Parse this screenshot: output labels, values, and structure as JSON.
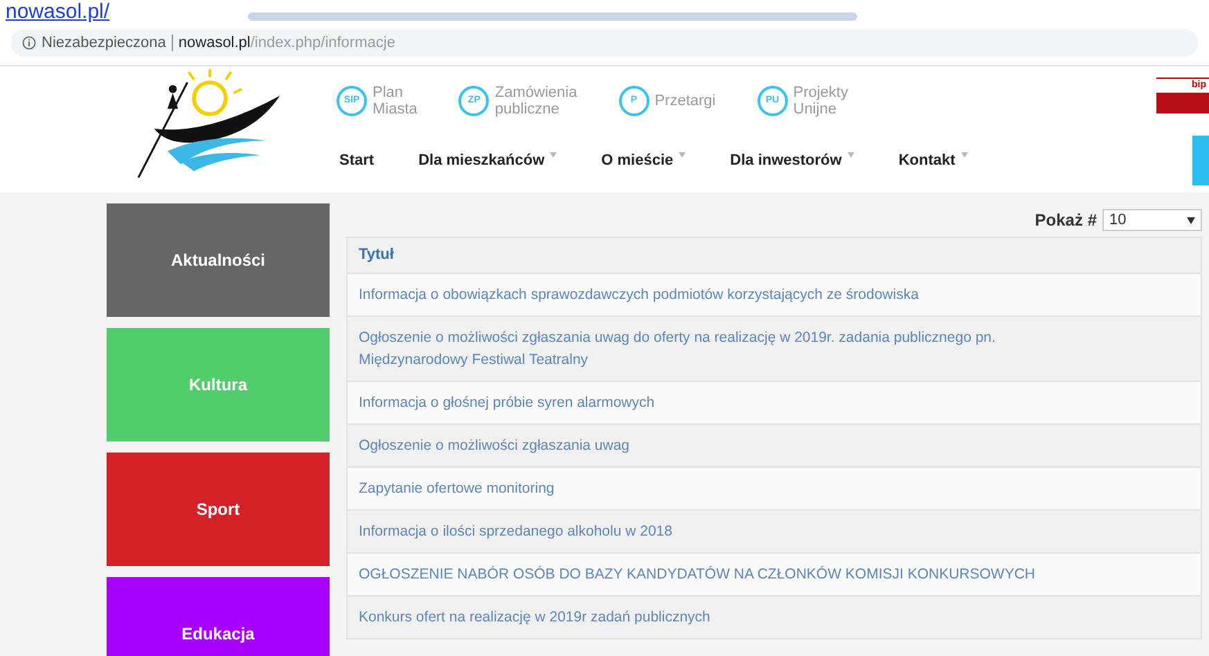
{
  "page_heading": "nowasol.pl/",
  "address_bar": {
    "security": "Niezabezpieczona",
    "domain": "nowasol.pl",
    "path": "/index.php/informacje"
  },
  "quick_links": [
    {
      "badge": "SIP",
      "label": "Plan Miasta"
    },
    {
      "badge": "ZP",
      "label": "Zamówienia publiczne"
    },
    {
      "badge": "P",
      "label": "Przetargi"
    },
    {
      "badge": "PU",
      "label": "Projekty Unijne"
    }
  ],
  "nav": [
    {
      "label": "Start",
      "dropdown": false
    },
    {
      "label": "Dla mieszkańców",
      "dropdown": true
    },
    {
      "label": "O mieście",
      "dropdown": true
    },
    {
      "label": "Dla inwestorów",
      "dropdown": true
    },
    {
      "label": "Kontakt",
      "dropdown": true
    }
  ],
  "bip_label": "bip",
  "sidebar_tiles": [
    {
      "label": "Aktualności",
      "color": "#666666"
    },
    {
      "label": "Kultura",
      "color": "#52cc6c"
    },
    {
      "label": "Sport",
      "color": "#d42127"
    },
    {
      "label": "Edukacja",
      "color": "#a800ff"
    }
  ],
  "page_size": {
    "label": "Pokaż #",
    "value": "10"
  },
  "table": {
    "columns": [
      "Tytuł"
    ],
    "rows": [
      "Informacja o obowiązkach sprawozdawczych podmiotów korzystających ze środowiska",
      "Ogłoszenie o możliwości zgłaszania uwag do oferty na realizację w 2019r. zadania publicznego pn. Międzynarodowy Festiwal Teatralny",
      "Informacja o głośnej próbie syren alarmowych",
      "Ogłoszenie o możliwości zgłaszania uwag",
      "Zapytanie ofertowe monitoring",
      "Informacja o ilości sprzedanego alkoholu w 2018",
      "OGŁOSZENIE NABÓR OSÓB DO BAZY KANDYDATÓW NA CZŁONKÓW KOMISJI KONKURSOWYCH",
      "Konkurs ofert na realizację w 2019r zadań publicznych"
    ]
  }
}
